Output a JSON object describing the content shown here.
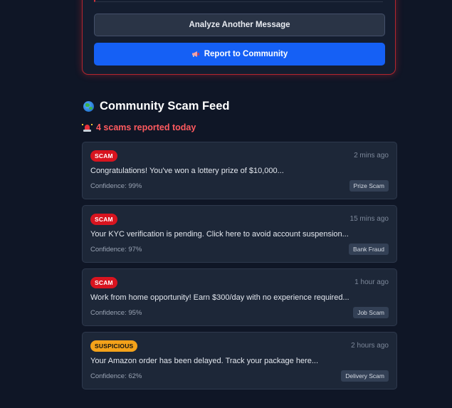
{
  "result_card": {
    "analyze_again_label": "Analyze Another Message",
    "report_label": "Report to Community",
    "report_icon": "megaphone-icon"
  },
  "feed": {
    "title": "Community Scam Feed",
    "title_icon": "globe-icon",
    "reported_today": "4 scams reported today",
    "reported_icon": "siren-icon",
    "items": [
      {
        "badge": "SCAM",
        "badge_type": "scam",
        "time": "2 mins ago",
        "message": "Congratulations! You've won a lottery prize of $10,000...",
        "confidence": "Confidence: 99%",
        "category": "Prize Scam"
      },
      {
        "badge": "SCAM",
        "badge_type": "scam",
        "time": "15 mins ago",
        "message": "Your KYC verification is pending. Click here to avoid account suspension...",
        "confidence": "Confidence: 97%",
        "category": "Bank Fraud"
      },
      {
        "badge": "SCAM",
        "badge_type": "scam",
        "time": "1 hour ago",
        "message": "Work from home opportunity! Earn $300/day with no experience required...",
        "confidence": "Confidence: 95%",
        "category": "Job Scam"
      },
      {
        "badge": "SUSPICIOUS",
        "badge_type": "suspicious",
        "time": "2 hours ago",
        "message": "Your Amazon order has been delayed. Track your package here...",
        "confidence": "Confidence: 62%",
        "category": "Delivery Scam"
      }
    ]
  },
  "colors": {
    "background": "#0f1626",
    "scam_red": "#d8141f",
    "suspicious_orange": "#f4a21a",
    "primary_blue": "#1560f5",
    "alert_text": "#ff5a5f"
  }
}
